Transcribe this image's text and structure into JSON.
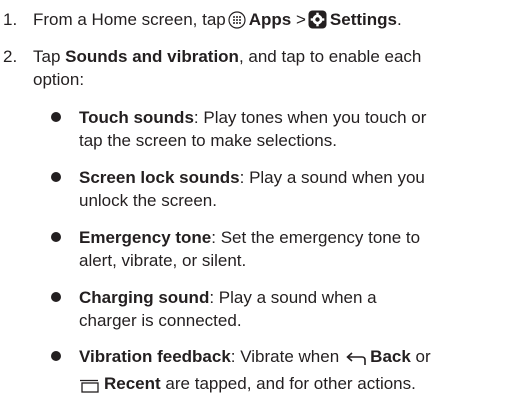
{
  "steps": [
    {
      "number": "1.",
      "prefix": "From a Home screen, tap",
      "apps_icon": "apps-grid-icon",
      "apps_label": "Apps",
      "separator": ">",
      "settings_icon": "settings-gear-icon",
      "settings_label": "Settings",
      "suffix": "."
    },
    {
      "number": "2.",
      "prefix": "Tap",
      "bold": "Sounds and vibration",
      "line1_rest": ", and tap to enable each",
      "line2": "option:"
    }
  ],
  "options": [
    {
      "term": "Touch sounds",
      "line1": ": Play tones when you touch or",
      "line2": "tap the screen to make selections."
    },
    {
      "term": "Screen lock sounds",
      "line1": ": Play a sound when you",
      "line2": "unlock the screen."
    },
    {
      "term": "Emergency tone",
      "line1": ": Set the emergency tone to",
      "line2": "alert, vibrate, or silent."
    },
    {
      "term": "Charging sound",
      "line1": ": Play a sound when a",
      "line2": "charger is connected."
    },
    {
      "term": "Vibration feedback",
      "line1": ": Vibrate when",
      "back_icon": "back-arrow-icon",
      "back_label": "Back",
      "line1_end": "or",
      "recent_icon": "recent-apps-icon",
      "recent_label": "Recent",
      "line2_end": "are tapped, and for other actions."
    }
  ]
}
